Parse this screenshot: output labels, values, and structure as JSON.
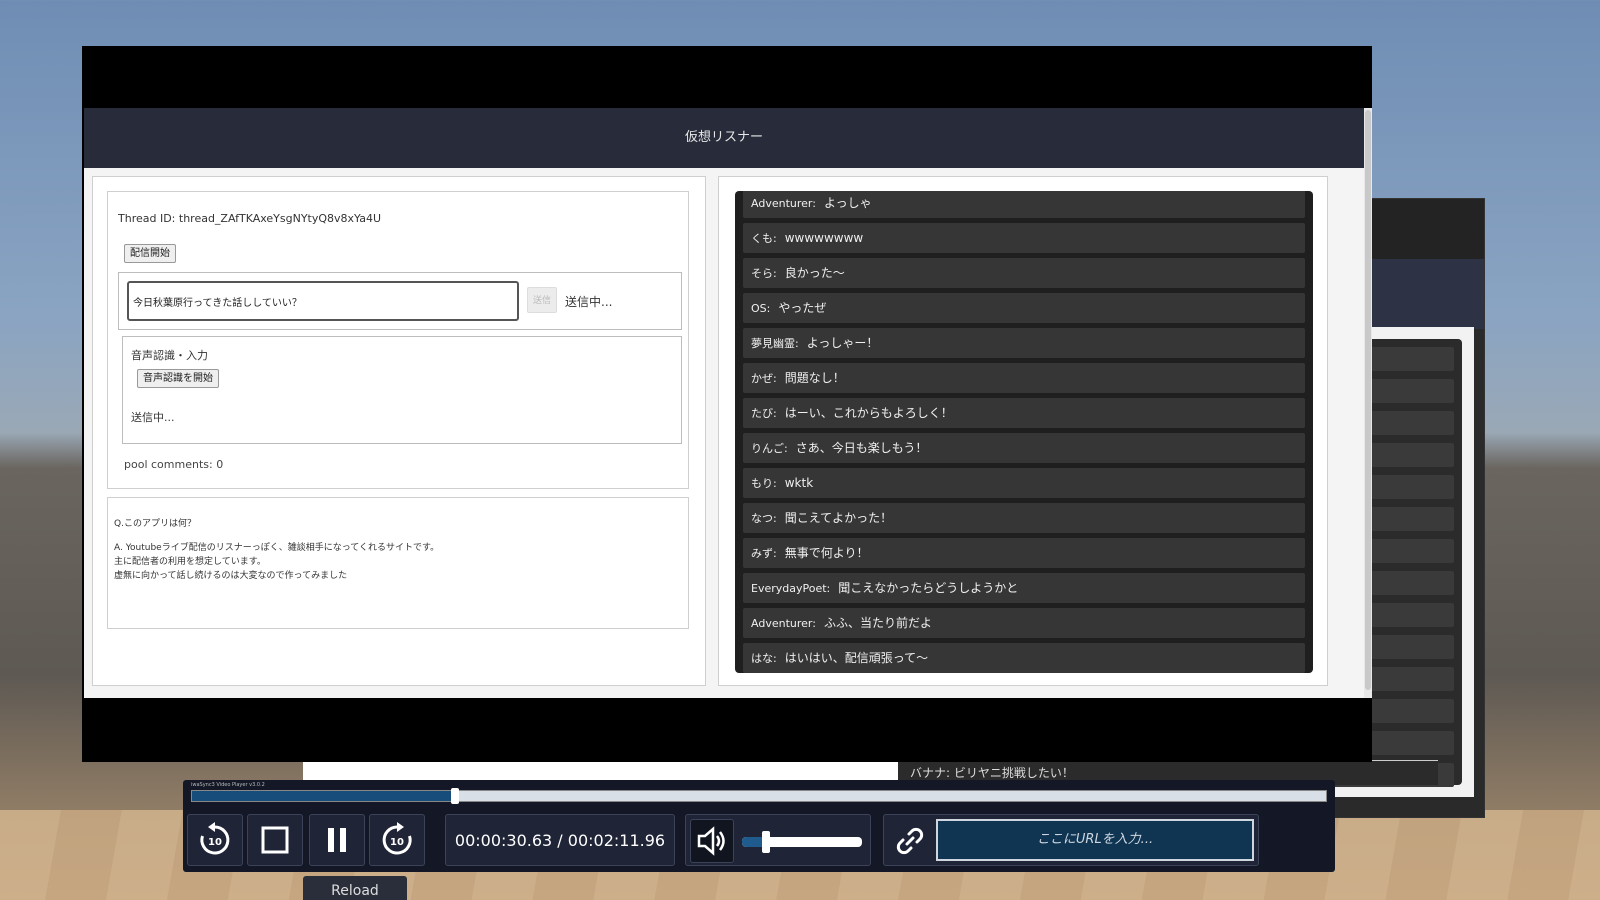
{
  "app": {
    "title": "仮想リスナー",
    "thread_id": "Thread ID: thread_ZAfTKAxeYsgNYtyQ8v8xYa4U",
    "start_stream_label": "配信開始",
    "comment_input_value": "今日秋葉原行ってきた話ししていい？",
    "send_label": "送信",
    "sending_status": "送信中...",
    "voice_section_title": "音声認識・入力",
    "voice_start_label": "音声認識を開始",
    "voice_status": "送信中...",
    "pool_comments": "pool comments: 0",
    "faq_question": "Q.このアプリは何？",
    "faq_answer_lines": [
      "A. Youtubeライブ配信のリスナーっぽく、雑談相手になってくれるサイトです。",
      "主に配信者の利用を想定しています。",
      "虚無に向かって話し続けるのは大変なので作ってみました"
    ]
  },
  "chat": [
    {
      "name": "Adventurer:",
      "text": "よっしゃ"
    },
    {
      "name": "くも:",
      "text": "wwwwwwww"
    },
    {
      "name": "そら:",
      "text": "良かった～"
    },
    {
      "name": "OS:",
      "text": "やったぜ"
    },
    {
      "name": "夢見幽霊:",
      "text": "よっしゃー！"
    },
    {
      "name": "かぜ:",
      "text": "問題なし！"
    },
    {
      "name": "たび:",
      "text": "はーい、これからもよろしく！"
    },
    {
      "name": "りんご:",
      "text": "さあ、今日も楽しもう！"
    },
    {
      "name": "もり:",
      "text": "wktk"
    },
    {
      "name": "なつ:",
      "text": "聞こえてよかった！"
    },
    {
      "name": "みず:",
      "text": "無事で何より！"
    },
    {
      "name": "EverydayPoet:",
      "text": "聞こえなかったらどうしようかと"
    },
    {
      "name": "Adventurer:",
      "text": "ふふ、当たり前だよ"
    },
    {
      "name": "はな:",
      "text": "はいはい、配信頑張って～"
    }
  ],
  "background_chat": {
    "name": "バナナ:",
    "text": "ビリヤニ挑戦したい！"
  },
  "player": {
    "title": "iwaSync3 Video Player v3.0.2",
    "time_display": "00:00:30.63 / 00:02:11.96",
    "progress": 0.2319,
    "volume": 0.2,
    "url_placeholder": "ここにURLを入力...",
    "rewind_label": "10",
    "forward_label": "10",
    "reload_label": "Reload"
  }
}
